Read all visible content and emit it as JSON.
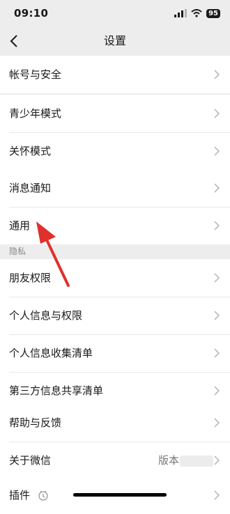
{
  "status": {
    "time": "09:10",
    "battery": "95"
  },
  "nav": {
    "title": "设置"
  },
  "groups": {
    "account": [
      "帐号与安全"
    ],
    "modes": [
      "青少年模式",
      "关怀模式"
    ],
    "general": [
      "消息通知",
      "通用"
    ],
    "privacy_header": "隐私",
    "privacy": [
      "朋友权限",
      "个人信息与权限",
      "个人信息收集清单",
      "第三方信息共享清单"
    ],
    "help": [
      "帮助与反馈",
      "关于微信"
    ],
    "about_value": "版本 8",
    "plugins": [
      "插件"
    ]
  },
  "colors": {
    "background": "#ededed",
    "annotation_arrow": "#e0302d"
  }
}
